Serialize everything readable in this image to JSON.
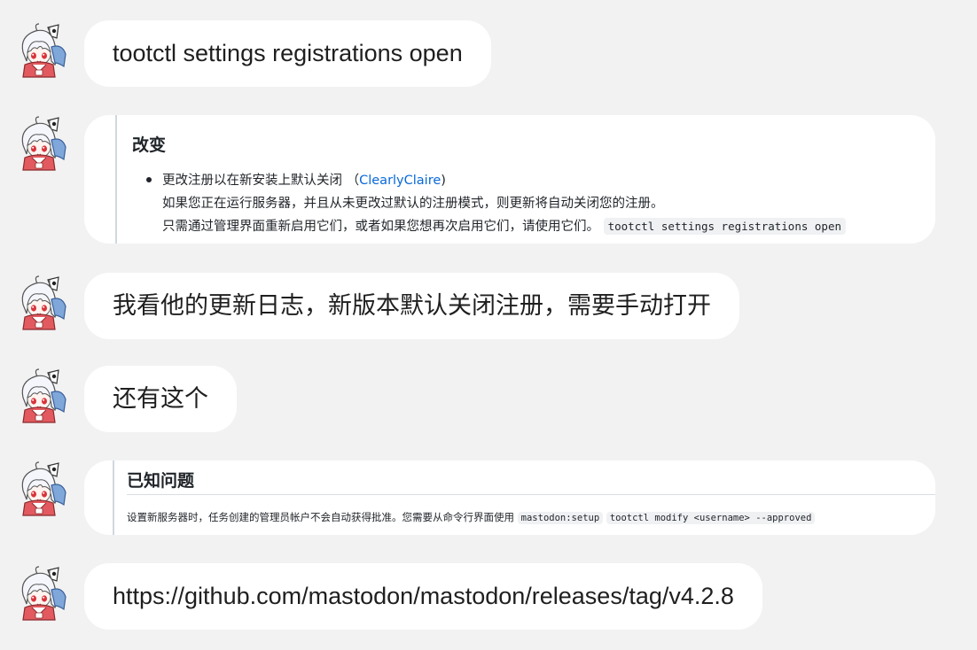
{
  "messages": [
    {
      "type": "text",
      "text": "tootctl settings registrations open"
    },
    {
      "type": "image",
      "title": "改变",
      "bullet_text": "更改注册以在新安装上默认关闭",
      "bullet_paren_open": "（",
      "bullet_link": "ClearlyClaire",
      "bullet_paren_close": ")",
      "line2": "如果您正在运行服务器，并且从未更改过默认的注册模式，则更新将自动关闭您的注册。",
      "line3": "只需通过管理界面重新启用它们，或者如果您想再次启用它们，请使用它们。",
      "line3_code": "tootctl settings registrations open"
    },
    {
      "type": "text",
      "text": "我看他的更新日志，新版本默认关闭注册，需要手动打开"
    },
    {
      "type": "text",
      "text": "还有这个"
    },
    {
      "type": "image",
      "title": "已知问题",
      "line": "设置新服务器时，任务创建的管理员帐户不会自动获得批准。您需要从命令行界面使用",
      "code1": "mastodon:setup",
      "code2": "tootctl modify <username> --approved"
    },
    {
      "type": "text",
      "text": "https://github.com/mastodon/mastodon/releases/tag/v4.2.8"
    }
  ],
  "colors": {
    "background": "#f2f2f2",
    "bubble": "#ffffff",
    "link": "#0969da"
  },
  "avatar_icon": "anime-girl-avatar"
}
